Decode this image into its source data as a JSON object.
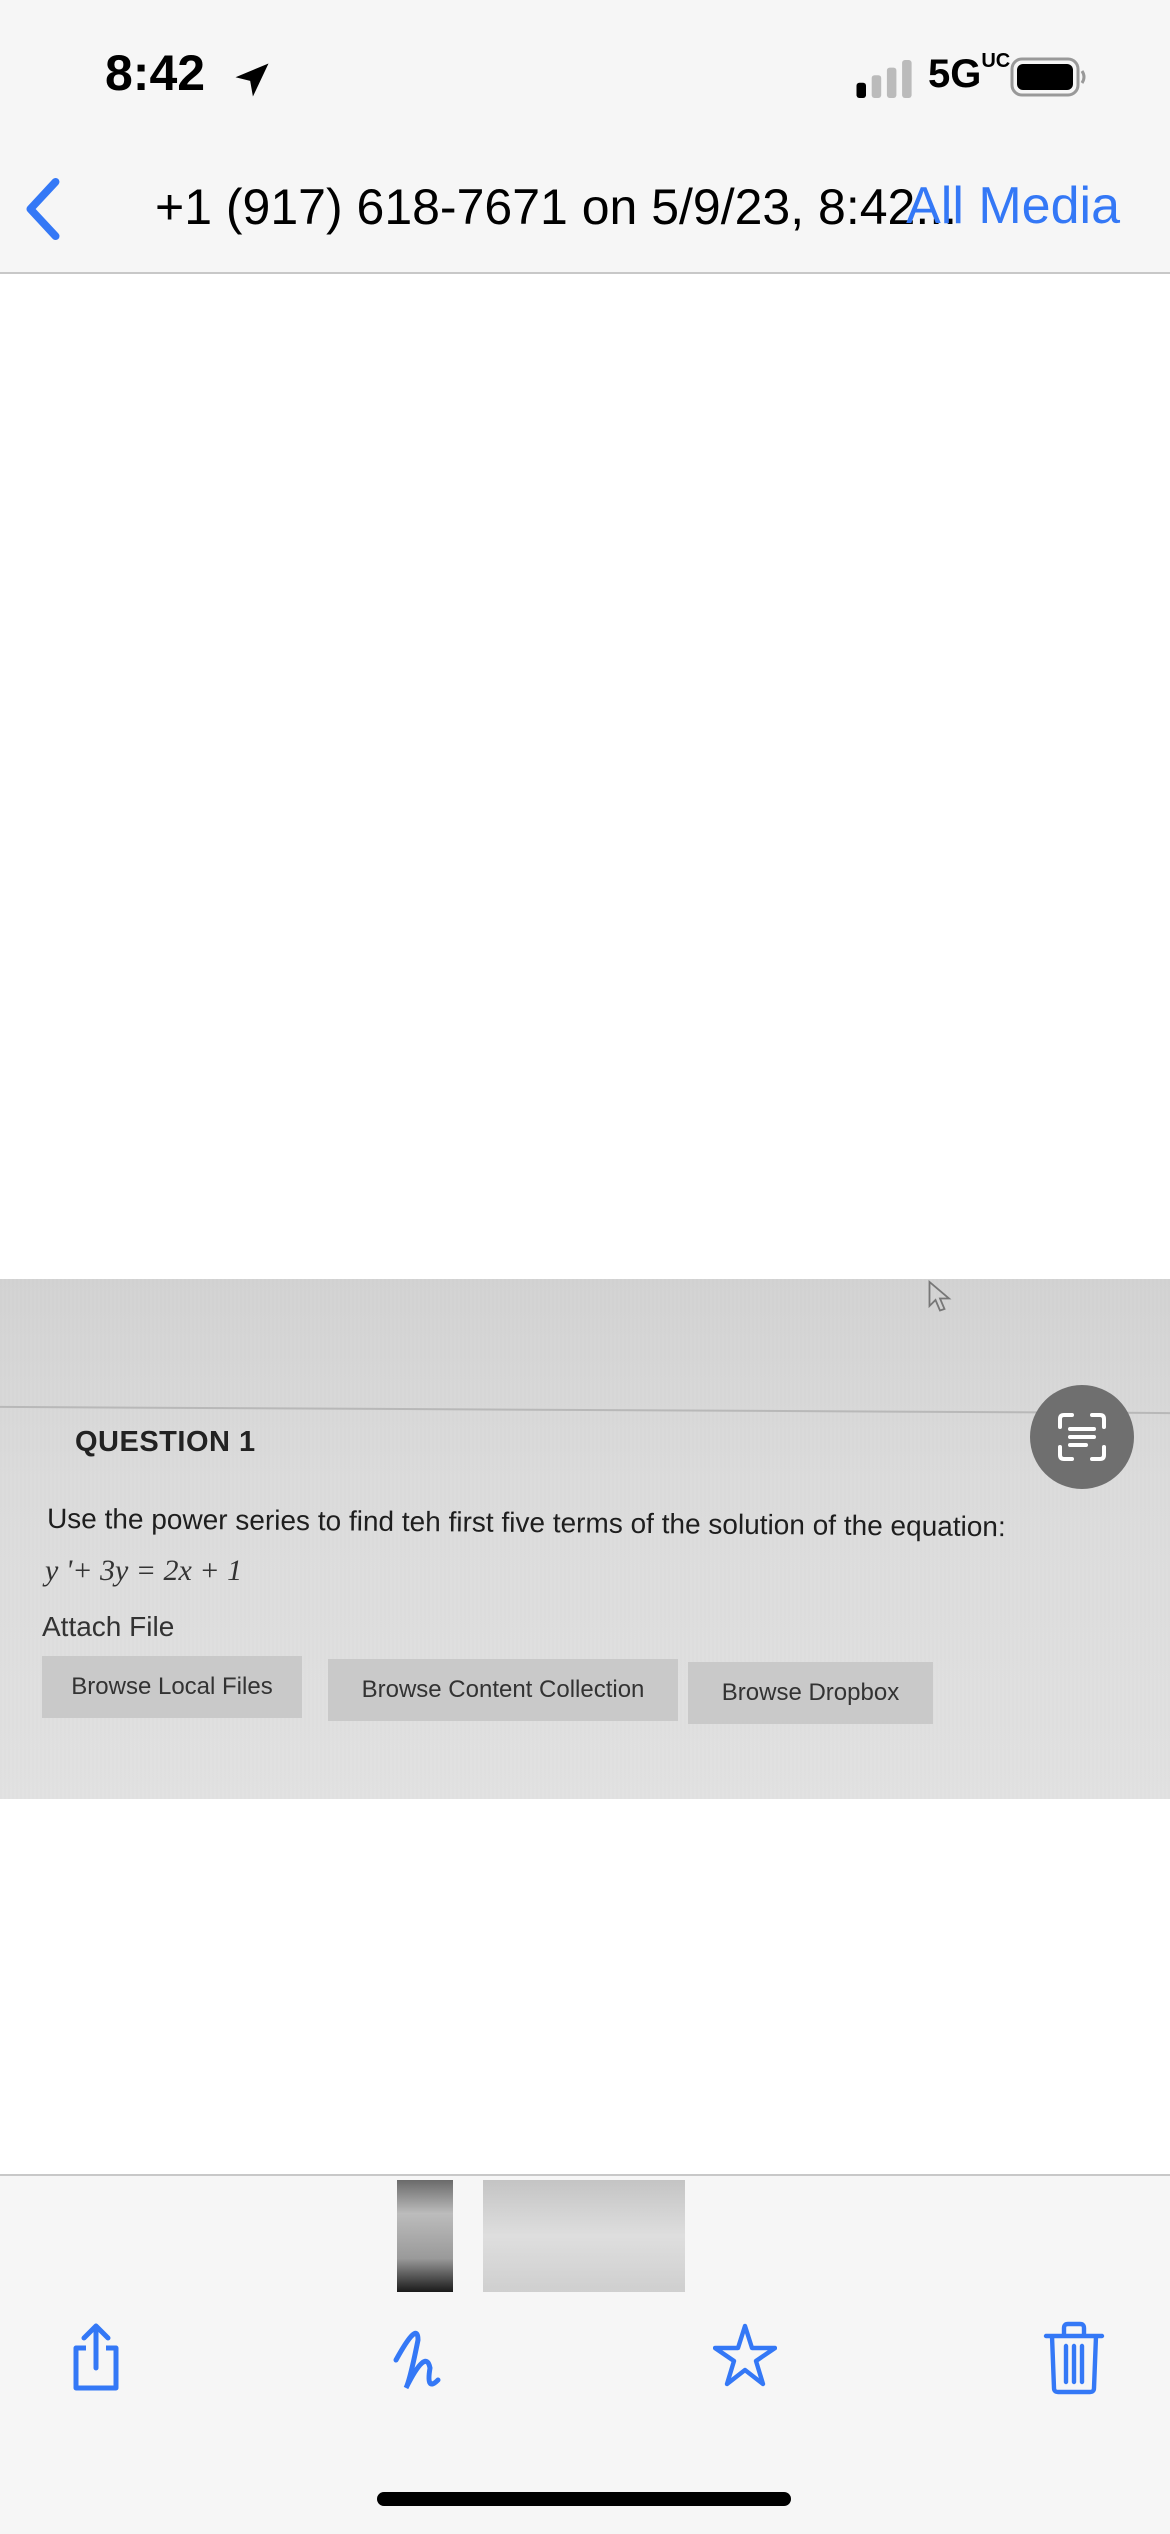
{
  "status_bar": {
    "time": "8:42",
    "network": "5G",
    "network_suffix": "UC",
    "location_icon": "location-arrow-icon",
    "signal_icon": "cellular-signal-icon",
    "battery_icon": "battery-icon"
  },
  "nav": {
    "back_icon": "chevron-left-icon",
    "title": "+1 (917) 618-7671 on 5/9/23, 8:42...",
    "action": "All Media"
  },
  "photo": {
    "question_title": "QUESTION 1",
    "question_text": "Use the power series to find teh first five terms of the solution of the equation:",
    "equation": "y '+ 3y = 2x + 1",
    "attach_label": "Attach File",
    "buttons": [
      "Browse Local Files",
      "Browse Content Collection",
      "Browse Dropbox"
    ]
  },
  "live_text_icon": "live-text-scan-icon",
  "toolbar": {
    "icons": [
      "share-icon",
      "markup-icon",
      "favorite-star-icon",
      "trash-icon"
    ]
  },
  "colors": {
    "accent": "#3478f6",
    "background": "#f6f6f6"
  }
}
